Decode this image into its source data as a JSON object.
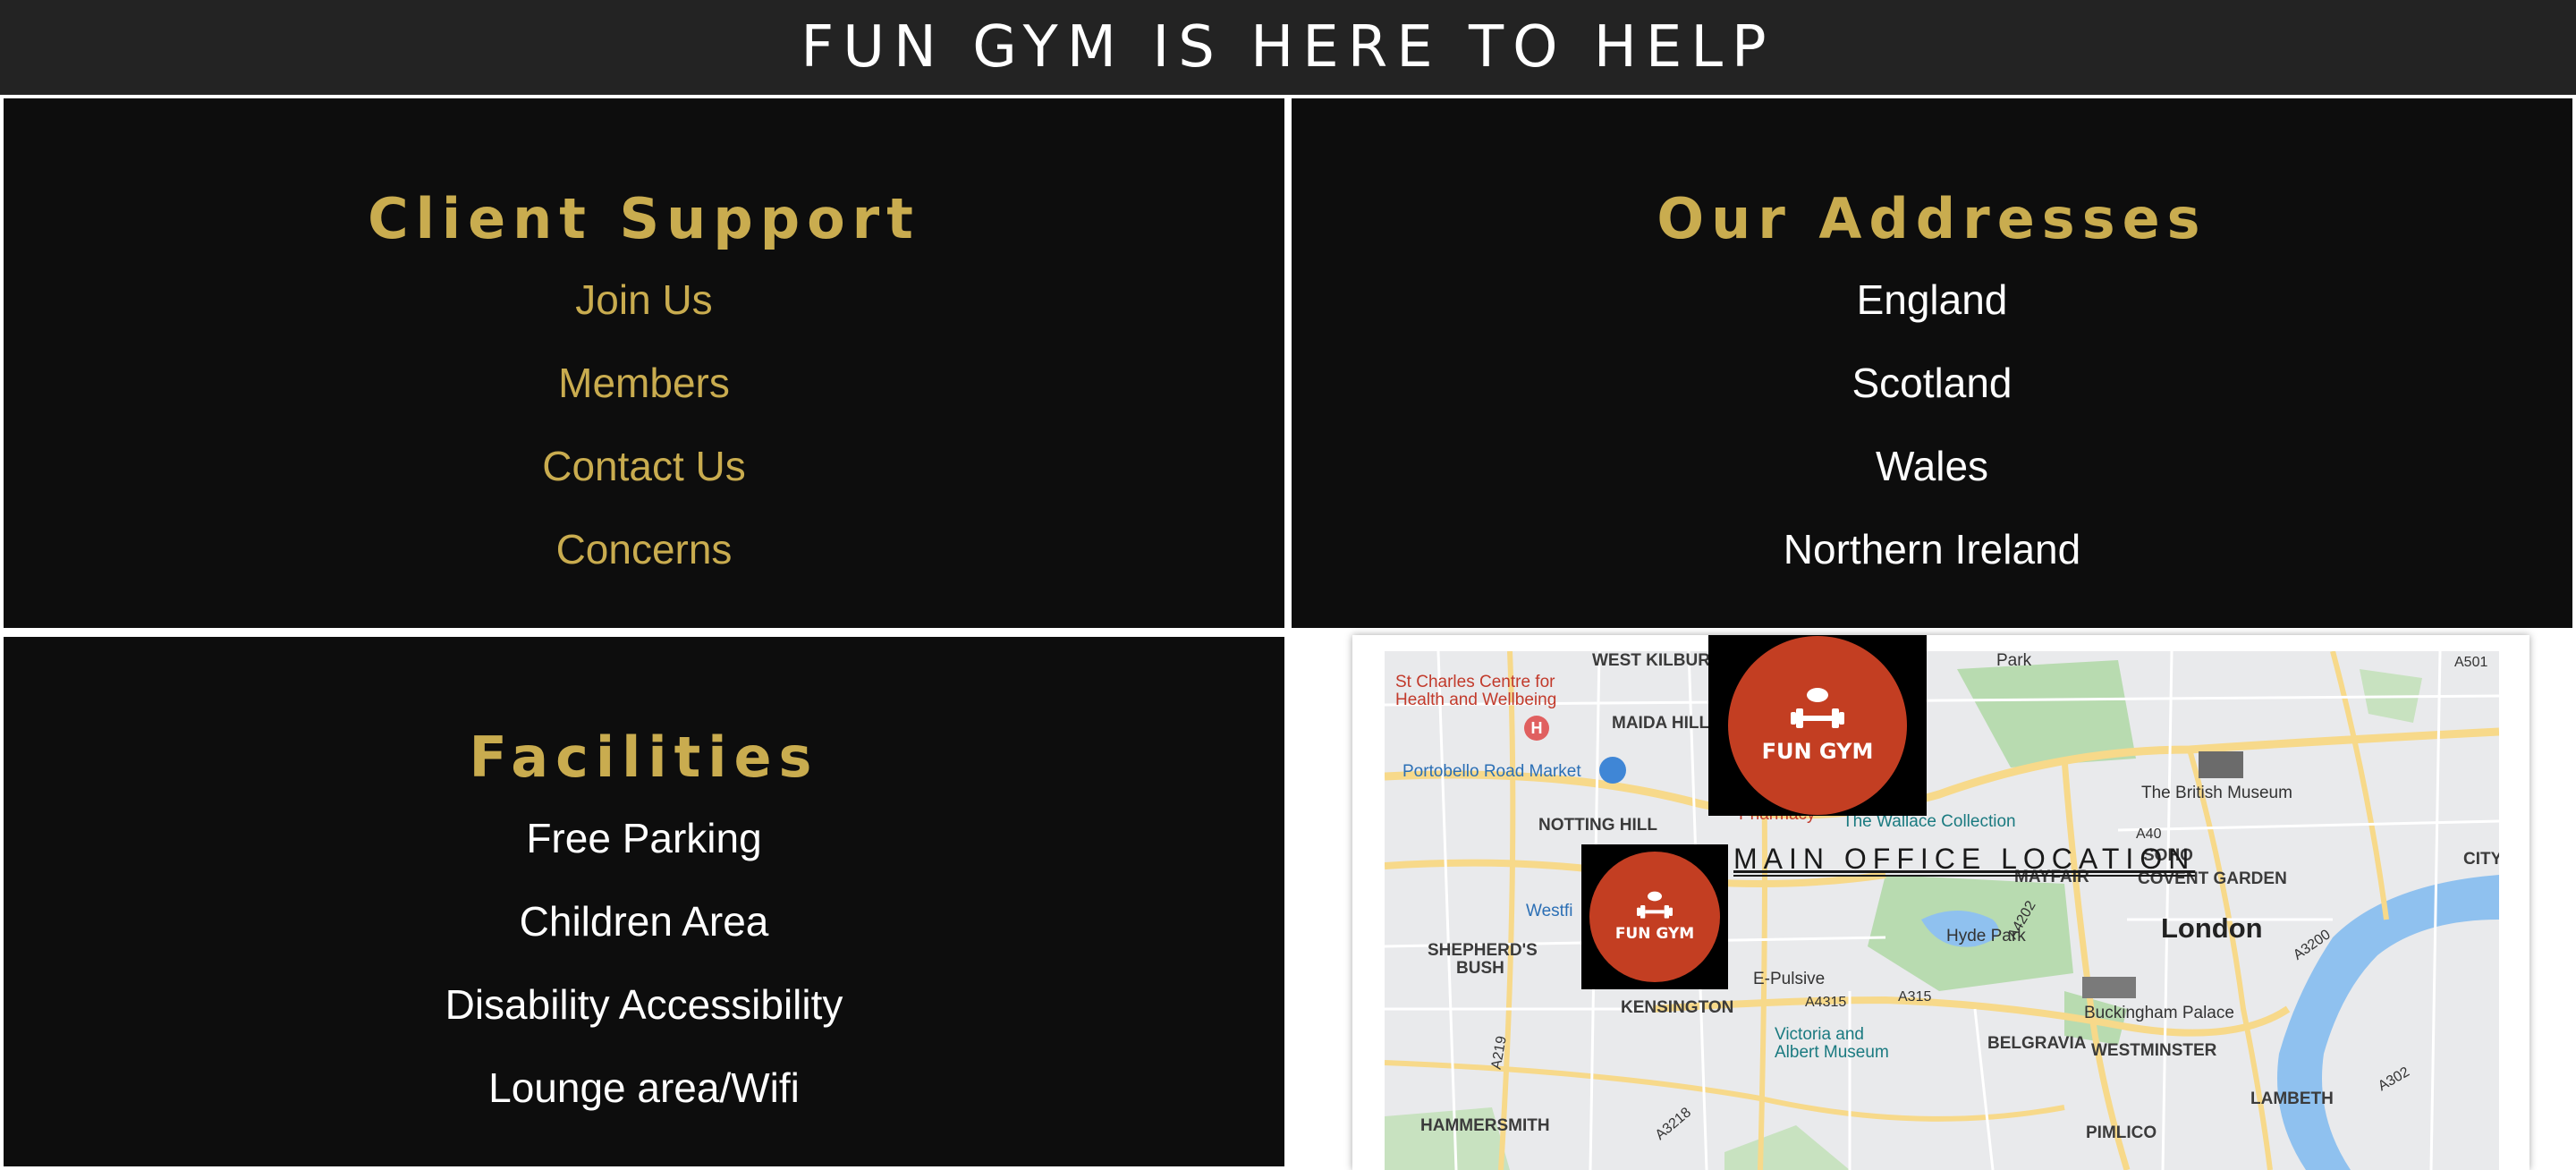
{
  "header": {
    "title": "FUN GYM IS HERE TO HELP"
  },
  "support": {
    "heading": "Client Support",
    "links": [
      "Join Us",
      "Members",
      "Contact Us",
      "Concerns"
    ]
  },
  "addresses": {
    "heading": "Our Addresses",
    "items": [
      "England",
      "Scotland",
      "Wales",
      "Northern Ireland"
    ]
  },
  "facilities": {
    "heading": "Facilities",
    "items": [
      "Free Parking",
      "Children Area",
      "Disability Accessibility",
      "Lounge area/Wifi"
    ]
  },
  "map": {
    "office_label": "MAIN OFFICE LOCATION",
    "logo_text": "FUN GYM",
    "labels": {
      "west_kilburn": "WEST KILBURN",
      "st_charles": "St Charles Centre for",
      "st_charles2": "Health and Wellbeing",
      "maida_hill": "MAIDA HILL",
      "portobello": "Portobello Road Market",
      "notting_hill": "NOTTING HILL",
      "shepherds_bush": "SHEPHERD'S",
      "shepherds_bush2": "BUSH",
      "kensington": "KENSINGTON",
      "hammersmith": "HAMMERSMITH",
      "london": "London",
      "mayfair": "MAYFAIR",
      "covent_garden": "COVENT GARDEN",
      "british_museum": "The British Museum",
      "wallace": "The Wallace Collection",
      "hyde_park": "Hyde Park",
      "buckingham": "Buckingham Palace",
      "belgravia": "BELGRAVIA",
      "westminster": "WESTMINSTER",
      "lambeth": "LAMBETH",
      "pimlico": "PIMLICO",
      "victoria_albert": "Victoria and",
      "victoria_albert2": "Albert Museum",
      "epulsive": "E-Pulsive",
      "park": "Park",
      "soho": "SOHO",
      "city": "CITY",
      "westfield": "Westfi",
      "pharmacy": "Pharmacy",
      "a501": "A501",
      "a40": "A40",
      "a4202": "A4202",
      "a3200": "A3200",
      "a4315": "A4315",
      "a315": "A315",
      "a219": "A219",
      "a3218": "A3218",
      "a302": "A302"
    }
  },
  "colors": {
    "header_bg": "#232323",
    "panel_bg": "#0d0d0d",
    "gold": "#c9ac4f",
    "logo_red": "#c33e22"
  },
  "icons": {
    "dumbbell": "dumbbell-icon",
    "museum": "museum-icon",
    "hospital": "hospital-icon",
    "shopping": "shopping-bag-icon",
    "landmark": "landmark-icon"
  }
}
